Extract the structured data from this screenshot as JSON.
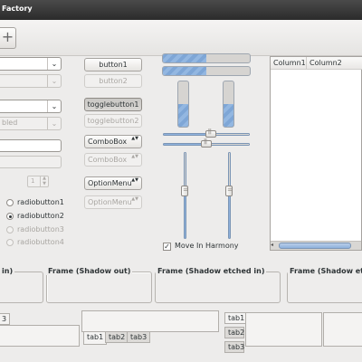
{
  "window": {
    "title": "Factory"
  },
  "toolbar": {
    "add_symbol": "+"
  },
  "combo_arrow": "⌄",
  "spin": {
    "value": "1",
    "up": "▲",
    "down": "▼"
  },
  "left_column": {
    "combo3_text": "bled",
    "radios": [
      {
        "label": "radiobutton1",
        "checked": false,
        "disabled": false
      },
      {
        "label": "radiobutton2",
        "checked": true,
        "disabled": false
      },
      {
        "label": "radiobutton3",
        "checked": false,
        "disabled": true
      },
      {
        "label": "radiobutton4",
        "checked": false,
        "disabled": true
      }
    ]
  },
  "buttons": {
    "button1": "button1",
    "button2": "button2",
    "togglebutton1": "togglebutton1",
    "togglebutton2": "togglebutton2",
    "combobox1": "ComboBox",
    "combobox2": "ComboBox",
    "optionmenu1": "OptionMenu",
    "optionmenu2": "OptionMenu",
    "updown_arrows": "▲▼"
  },
  "progress": {
    "hbar1_fraction": 0.5,
    "hbar2_fraction": 0.5,
    "vbar1_fraction": 0.5,
    "vbar2_fraction": 0.5
  },
  "sliders": {
    "hslider1_fraction": 0.55,
    "hslider2_fraction": 0.5,
    "vslider1_fraction": 0.45,
    "vslider2_fraction": 0.45
  },
  "check": {
    "label": "Move In Harmony",
    "checked": true,
    "mark": "✓"
  },
  "treeview": {
    "columns": [
      "Column1",
      "Column2"
    ],
    "scroll_left": "◂"
  },
  "frames": [
    {
      "label": "in)"
    },
    {
      "label": "Frame (Shadow out)"
    },
    {
      "label": "Frame (Shadow etched in)"
    },
    {
      "label": "Frame (Shadow etch"
    }
  ],
  "tabs": {
    "left_tab": "3",
    "bottom_tabs": [
      "tab1",
      "tab2",
      "tab3"
    ],
    "side_tabs": [
      "tab1",
      "tab2",
      "tab3"
    ]
  }
}
